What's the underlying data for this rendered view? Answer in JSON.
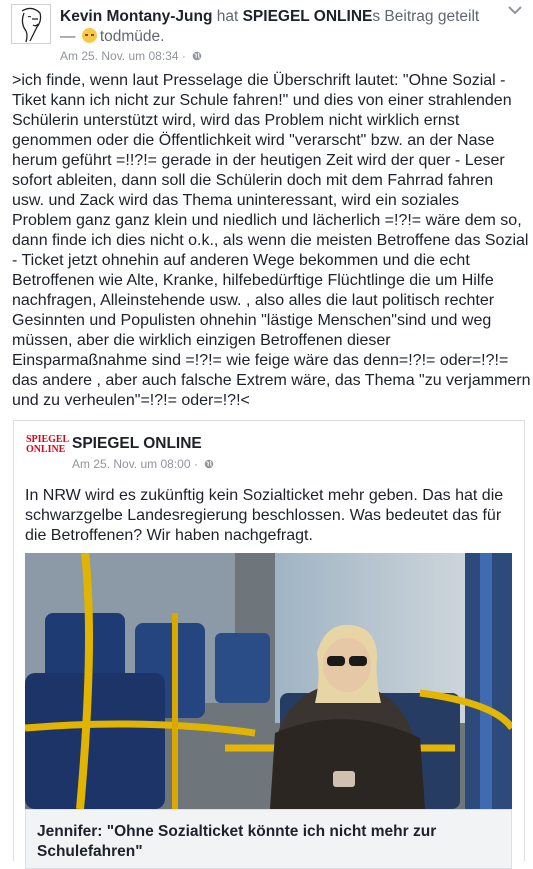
{
  "post": {
    "author": "Kevin Montany-Jung",
    "shared_word": " hat ",
    "shared_page": "SPIEGEL ONLINE",
    "shared_suffix": "s Beitrag geteilt",
    "feeling_prefix": "— ",
    "feeling": "todmüde.",
    "timestamp": "Am 25. Nov. um 08:34",
    "dot": " ·",
    "body_lines": [
      ">ich finde, wenn laut Presselage die Überschrift lautet: \"Ohne Sozial -",
      "Tiket kann ich nicht zur Schule fahren!\" und dies von einer strahlenden",
      "Schülerin unterstützt  wird, wird  das Problem nicht wirklich ernst",
      "genommen oder die Öffentlichkeit wird \"verarscht\" bzw. an der Nase",
      "herum geführt =!!?!= gerade in der heutigen Zeit wird der quer - Leser",
      "sofort ableiten, dann soll die Schülerin doch mit dem Fahrrad fahren",
      "usw. und Zack wird das Thema uninteressant,  wird ein soziales",
      "Problem ganz ganz klein und niedlich und lächerlich =!?!= wäre dem so,",
      "dann finde ich dies nicht o.k., als wenn die meisten Betroffene das Sozial",
      "- Ticket jetzt ohnehin auf anderen Wege bekommen und die echt",
      "Betroffenen wie Alte, Kranke, hilfebedürftige Flüchtlinge die um Hilfe",
      "nachfragen,  Alleinstehende usw. , also alles die laut politisch rechter",
      "Gesinnten  und Populisten ohnehin \"lästige Menschen\"sind und weg",
      "müssen, aber die wirklich einzigen Betroffenen dieser",
      "Einsparmaßnahme sind =!?!= wie feige wäre das denn=!?!= oder=!?!=",
      "das andere , aber auch falsche Extrem wäre, das Thema \"zu verjammern",
      "und zu verheulen\"=!?!= oder=!?!<"
    ]
  },
  "shared": {
    "logo_line1": "SPIEGEL",
    "logo_line2": "ONLINE",
    "page_name": "SPIEGEL ONLINE",
    "timestamp": "Am 25. Nov. um 08:00",
    "dot": " ·",
    "text_lines": [
      "In NRW wird es zukünftig kein Sozialticket mehr geben. Das hat die",
      "schwarzgelbe Landesregierung beschlossen. Was bedeutet das für",
      "die Betroffenen? Wir haben nachgefragt."
    ],
    "link_title_lines": [
      "Jennifer: \"Ohne Sozialticket könnte ich nicht mehr zur Schule",
      "fahren\""
    ]
  },
  "icons": {
    "globe": "globe-icon",
    "chevron": "chevron-down-icon",
    "avatar": "avatar-drawing",
    "feeling": "sleepy-face-icon"
  },
  "colors": {
    "text": "#1d2129",
    "secondary": "#606770",
    "meta": "#90949c",
    "spiegel_red": "#e0001a",
    "link_bg": "#f2f3f5"
  }
}
